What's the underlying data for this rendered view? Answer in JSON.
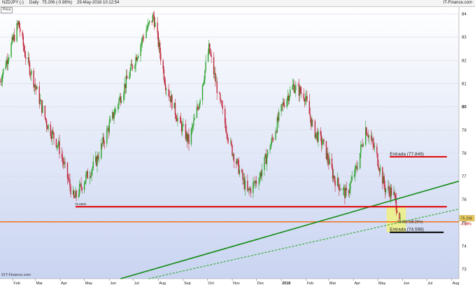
{
  "header": {
    "symbol": "NZDJPY (-)",
    "interval": "Daily",
    "last_change": "75.206 (-0.98%)",
    "datetime": "29-May-2018 10:12:54",
    "brand": "IT-Finance.com"
  },
  "price_tag": "Price",
  "watermark": "©IT-Finance.com",
  "colors": {
    "up": "#2aa02a",
    "down": "#c0283c",
    "red_line": "#e00000",
    "green_line": "#138a13",
    "orange_line": "#f07020",
    "highlight": "#eef08a"
  },
  "chart_data": {
    "type": "candlestick",
    "title": "",
    "xlabel": "",
    "ylabel": "Price",
    "ylim": [
      72.6,
      84.3
    ],
    "y_ticks": [
      "73",
      "74",
      "75",
      "76",
      "77",
      "78",
      "79",
      "80",
      "81",
      "82",
      "83",
      "84"
    ],
    "y_tick_values": [
      73,
      74,
      75,
      76,
      77,
      78,
      79,
      80,
      81,
      82,
      83,
      84
    ],
    "x_start": "2017-01-16",
    "x_end": "2018-08-10",
    "x_ticks": [
      {
        "label": "Feb",
        "date": "2017-02-01"
      },
      {
        "label": "Mar",
        "date": "2017-03-01"
      },
      {
        "label": "Apr",
        "date": "2017-04-01"
      },
      {
        "label": "May",
        "date": "2017-05-01"
      },
      {
        "label": "Jun",
        "date": "2017-06-01"
      },
      {
        "label": "Jul",
        "date": "2017-07-01"
      },
      {
        "label": "Aug",
        "date": "2017-08-01"
      },
      {
        "label": "Sep",
        "date": "2017-09-01"
      },
      {
        "label": "Oct",
        "date": "2017-10-01"
      },
      {
        "label": "Nov",
        "date": "2017-11-01"
      },
      {
        "label": "Dec",
        "date": "2017-12-01"
      },
      {
        "label": "2018",
        "date": "2018-01-01"
      },
      {
        "label": "Feb",
        "date": "2018-02-01"
      },
      {
        "label": "Mar",
        "date": "2018-03-01"
      },
      {
        "label": "Apr",
        "date": "2018-04-01"
      },
      {
        "label": "May",
        "date": "2018-05-01"
      },
      {
        "label": "Jun",
        "date": "2018-06-01"
      },
      {
        "label": "Jul",
        "date": "2018-07-01"
      },
      {
        "label": "Aug",
        "date": "2018-08-01"
      }
    ],
    "price_path": [
      {
        "date": "2017-01-16",
        "price": 81.1
      },
      {
        "date": "2017-01-25",
        "price": 82.1
      },
      {
        "date": "2017-02-08",
        "price": 83.6
      },
      {
        "date": "2017-02-16",
        "price": 82.3
      },
      {
        "date": "2017-02-28",
        "price": 81.0
      },
      {
        "date": "2017-03-15",
        "price": 79.3
      },
      {
        "date": "2017-03-30",
        "price": 78.3
      },
      {
        "date": "2017-04-18",
        "price": 76.0
      },
      {
        "date": "2017-05-02",
        "price": 76.9
      },
      {
        "date": "2017-05-15",
        "price": 77.6
      },
      {
        "date": "2017-06-01",
        "price": 79.2
      },
      {
        "date": "2017-06-20",
        "price": 80.9
      },
      {
        "date": "2017-07-06",
        "price": 82.3
      },
      {
        "date": "2017-07-14",
        "price": 83.1
      },
      {
        "date": "2017-07-26",
        "price": 83.9
      },
      {
        "date": "2017-08-10",
        "price": 81.0
      },
      {
        "date": "2017-08-25",
        "price": 79.5
      },
      {
        "date": "2017-09-08",
        "price": 78.5
      },
      {
        "date": "2017-09-20",
        "price": 80.1
      },
      {
        "date": "2017-10-03",
        "price": 82.5
      },
      {
        "date": "2017-10-16",
        "price": 80.3
      },
      {
        "date": "2017-10-30",
        "price": 78.3
      },
      {
        "date": "2017-11-20",
        "price": 76.3
      },
      {
        "date": "2017-12-05",
        "price": 77.0
      },
      {
        "date": "2017-12-20",
        "price": 78.5
      },
      {
        "date": "2018-01-03",
        "price": 80.1
      },
      {
        "date": "2018-01-16",
        "price": 80.9
      },
      {
        "date": "2018-01-30",
        "price": 80.5
      },
      {
        "date": "2018-02-10",
        "price": 79.0
      },
      {
        "date": "2018-02-22",
        "price": 78.4
      },
      {
        "date": "2018-03-08",
        "price": 76.9
      },
      {
        "date": "2018-03-23",
        "price": 76.2
      },
      {
        "date": "2018-04-05",
        "price": 77.4
      },
      {
        "date": "2018-04-16",
        "price": 79.1
      },
      {
        "date": "2018-04-28",
        "price": 78.1
      },
      {
        "date": "2018-05-10",
        "price": 76.5
      },
      {
        "date": "2018-05-20",
        "price": 76.3
      },
      {
        "date": "2018-05-29",
        "price": 75.2
      }
    ],
    "annotations": {
      "red_support": {
        "price": 75.7,
        "from": "2017-04-20",
        "to": "2018-07-26",
        "label": "75.6860"
      },
      "red_target": {
        "price": 77.849,
        "from": "2018-05-16",
        "to": "2018-07-26",
        "label": "Entrada (77.849)"
      },
      "black_target": {
        "price": 74.598,
        "from": "2018-05-16",
        "to": "2018-07-22",
        "label": "Entrada (74.598)"
      },
      "orange_level": {
        "price": 75.05,
        "label": "74.982 (38.25%)"
      },
      "green_trend": {
        "from": {
          "date": "2017-06-15",
          "price": 72.6
        },
        "to": {
          "date": "2018-08-10",
          "price": 76.8
        }
      },
      "green_dotted": {
        "from": {
          "date": "2017-07-20",
          "price": 72.6
        },
        "to": {
          "date": "2018-08-10",
          "price": 75.6
        }
      },
      "last_price": {
        "price": 75.206,
        "label": "75.206",
        "change": "-0.98%"
      },
      "highlight_zone": {
        "from": "2018-05-12",
        "to": "2018-06-05",
        "y_from": 74.6,
        "y_to": 75.7
      }
    }
  }
}
